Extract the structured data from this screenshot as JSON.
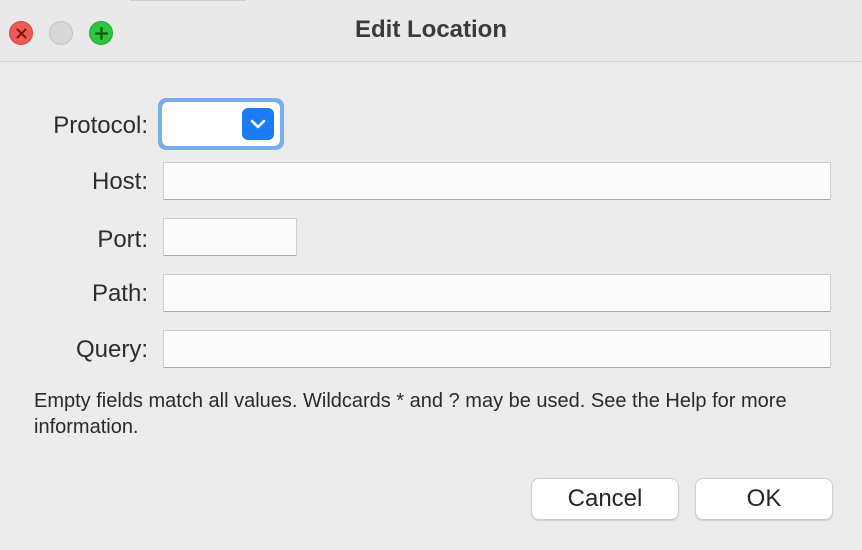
{
  "window": {
    "title": "Edit Location",
    "controls": {
      "close": "close-icon",
      "minimize": "minimize-icon",
      "zoom": "plus-icon"
    }
  },
  "form": {
    "protocol": {
      "label": "Protocol:",
      "value": "",
      "accent_color": "#1a7cf5",
      "focus_ring_color": "#7aaeea"
    },
    "host": {
      "label": "Host:",
      "value": ""
    },
    "port": {
      "label": "Port:",
      "value": ""
    },
    "path": {
      "label": "Path:",
      "value": ""
    },
    "query": {
      "label": "Query:",
      "value": ""
    }
  },
  "hint": "Empty fields match all values. Wildcards * and ? may be used. See the Help for more information.",
  "buttons": {
    "cancel": "Cancel",
    "ok": "OK"
  }
}
